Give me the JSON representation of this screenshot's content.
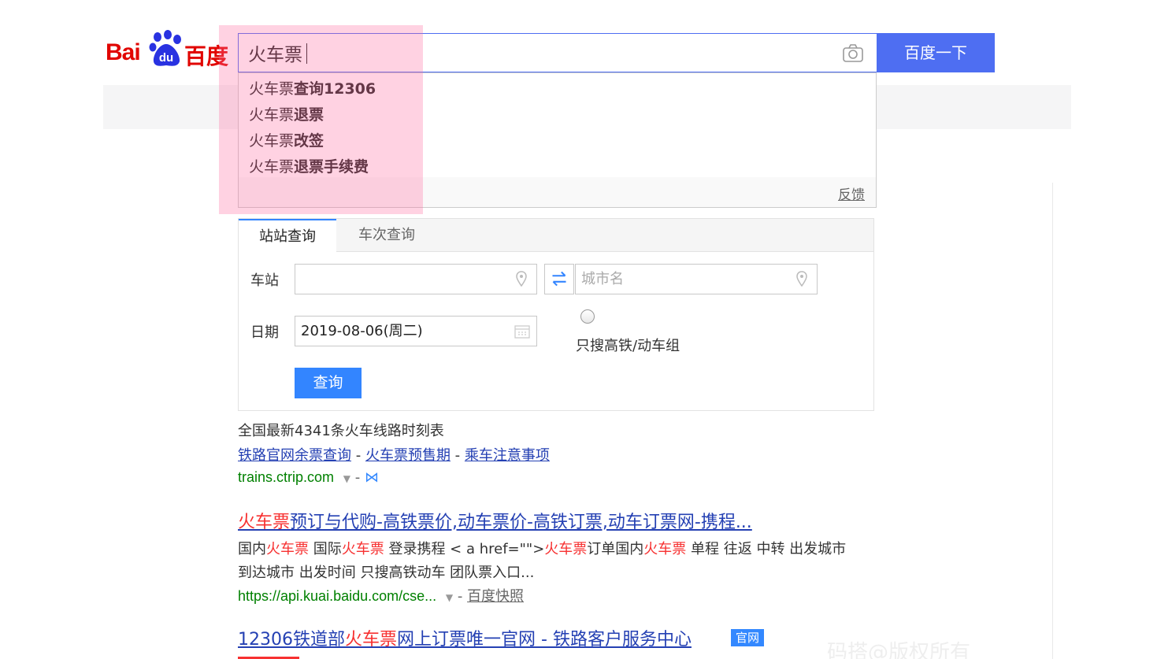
{
  "logo": {
    "latin": "Bai",
    "paw_text": "du",
    "chinese": "百度"
  },
  "search": {
    "query": "火车票",
    "button_label": "百度一下"
  },
  "suggestions": {
    "prefix": "火车票",
    "items": [
      {
        "label": "火车票查询12306",
        "bold": "查询12306"
      },
      {
        "label": "火车票退票",
        "bold": "退票"
      },
      {
        "label": "火车票改签",
        "bold": "改签"
      },
      {
        "label": "火车票退票手续费",
        "bold": "退票手续费"
      }
    ],
    "feedback": "反馈"
  },
  "train_widget": {
    "tabs": [
      "站站查询",
      "车次查询"
    ],
    "station_label": "车站",
    "from_value": "",
    "to_placeholder": "城市名",
    "date_label": "日期",
    "date_value": "2019-08-06(周二)",
    "highspeed_label": "只搜高铁/动车组",
    "query_button": "查询"
  },
  "result1": {
    "summary": "全国最新4341条火车线路时刻表",
    "links": [
      "铁路官网余票查询",
      "火车票预售期",
      "乘车注意事项"
    ],
    "separator": " - ",
    "url": "trains.ctrip.com",
    "url_suffix": "- "
  },
  "result2": {
    "title_red": "火车票",
    "title_rest": "预订与代购-高铁票价,动车票价-高铁订票,动车订票网-携程...",
    "desc_parts": [
      "国内",
      "火车票",
      " 国际",
      "火车票",
      " 登录携程 < a href=\"\">",
      "火车票",
      "订单国内",
      "火车票",
      " 单程 往返 中转 出发城市"
    ],
    "desc_line2": "到达城市 出发时间 只搜高铁动车 团队票入口...",
    "url": "https://api.kuai.baidu.com/cse...",
    "url_suffix": "- ",
    "snapshot": "百度快照"
  },
  "result3": {
    "title_a": "12306铁道部",
    "title_red": "火车票",
    "title_b": "网上订票唯一官网 - 铁路客户服务中心",
    "badge": "官网"
  },
  "watermark": "码搭@版权所有",
  "colors": {
    "accent": "#4e6ef2",
    "link": "#2440b3",
    "highlight_red": "#f73131",
    "url_green": "#008000",
    "query_blue": "#3385ff"
  }
}
